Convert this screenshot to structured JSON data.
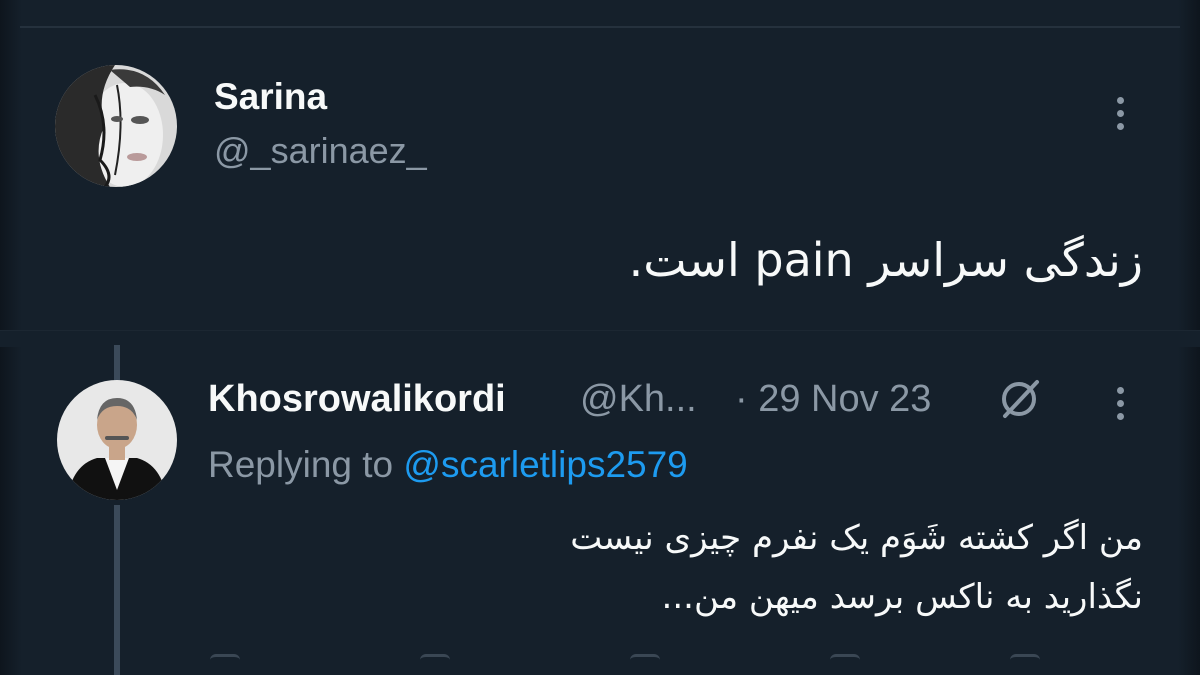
{
  "main_tweet": {
    "name": "Sarina",
    "handle": "@_sarinaez_",
    "text": "زندگی سراسر pain است.",
    "more_icon": "more-vertical-icon"
  },
  "reply_tweet": {
    "name": "Khosrowalikordi",
    "handle": "@Kh...",
    "date": "· 29 Nov 23",
    "replying_prefix": "Replying to",
    "replying_mention": "@scarletlips2579",
    "text_line1": "من اگر کشته شَوَم یک نفرم چیزی نیست",
    "text_line2": "نگذارید به ناکس برسد میهن من...",
    "edited_icon": "slash-circle-icon",
    "more_icon": "more-vertical-icon"
  },
  "colors": {
    "background": "#15202b",
    "primary_text": "#f7f9f9",
    "secondary_text": "#8b98a5",
    "accent": "#1d9bf0"
  }
}
